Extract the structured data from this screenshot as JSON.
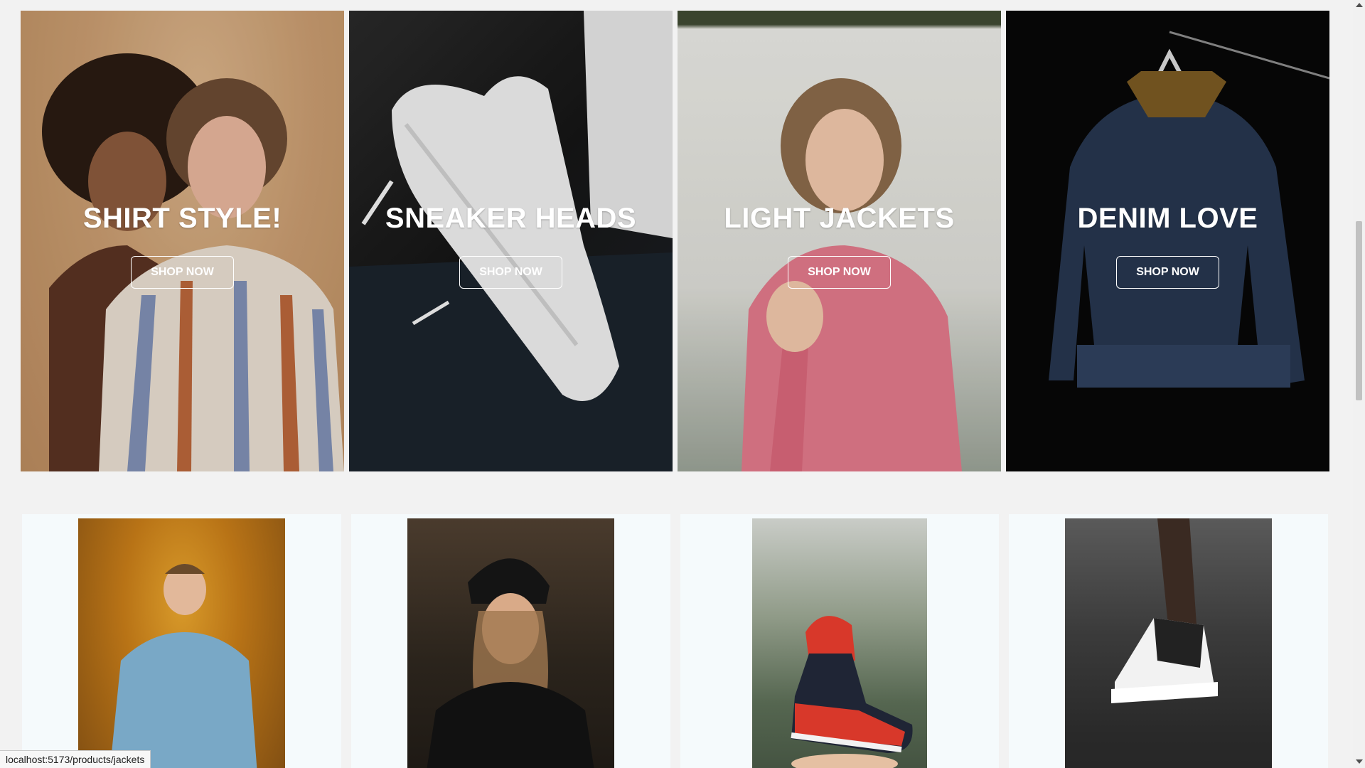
{
  "categories": [
    {
      "title": "SHIRT STYLE!",
      "button": "SHOP NOW",
      "image": "woman-striped-shirt-photo"
    },
    {
      "title": "SNEAKER HEADS",
      "button": "SHOP NOW",
      "image": "white-sneaker-photo"
    },
    {
      "title": "LIGHT JACKETS",
      "button": "SHOP NOW",
      "image": "woman-pink-jacket-photo"
    },
    {
      "title": "DENIM LOVE",
      "button": "SHOP NOW",
      "image": "denim-jacket-hanger-photo"
    }
  ],
  "products": [
    {
      "image": "man-blue-shirt-autumn-photo"
    },
    {
      "image": "woman-beanie-black-tee-photo"
    },
    {
      "image": "hand-holding-red-sneaker-photo"
    },
    {
      "image": "high-top-sneaker-rain-photo"
    }
  ],
  "status_bar": {
    "url": "localhost:5173/products/jackets"
  },
  "colors": {
    "page_background": "#f2f2f2",
    "product_card_background": "#f5fafc",
    "text_on_image": "#ffffff"
  }
}
